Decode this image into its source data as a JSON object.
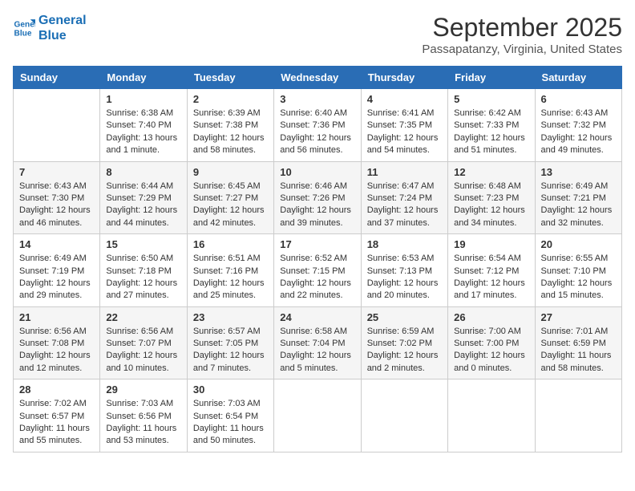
{
  "header": {
    "logo_line1": "General",
    "logo_line2": "Blue",
    "month": "September 2025",
    "location": "Passapatanzy, Virginia, United States"
  },
  "weekdays": [
    "Sunday",
    "Monday",
    "Tuesday",
    "Wednesday",
    "Thursday",
    "Friday",
    "Saturday"
  ],
  "weeks": [
    [
      {
        "day": "",
        "info": ""
      },
      {
        "day": "1",
        "info": "Sunrise: 6:38 AM\nSunset: 7:40 PM\nDaylight: 13 hours\nand 1 minute."
      },
      {
        "day": "2",
        "info": "Sunrise: 6:39 AM\nSunset: 7:38 PM\nDaylight: 12 hours\nand 58 minutes."
      },
      {
        "day": "3",
        "info": "Sunrise: 6:40 AM\nSunset: 7:36 PM\nDaylight: 12 hours\nand 56 minutes."
      },
      {
        "day": "4",
        "info": "Sunrise: 6:41 AM\nSunset: 7:35 PM\nDaylight: 12 hours\nand 54 minutes."
      },
      {
        "day": "5",
        "info": "Sunrise: 6:42 AM\nSunset: 7:33 PM\nDaylight: 12 hours\nand 51 minutes."
      },
      {
        "day": "6",
        "info": "Sunrise: 6:43 AM\nSunset: 7:32 PM\nDaylight: 12 hours\nand 49 minutes."
      }
    ],
    [
      {
        "day": "7",
        "info": "Sunrise: 6:43 AM\nSunset: 7:30 PM\nDaylight: 12 hours\nand 46 minutes."
      },
      {
        "day": "8",
        "info": "Sunrise: 6:44 AM\nSunset: 7:29 PM\nDaylight: 12 hours\nand 44 minutes."
      },
      {
        "day": "9",
        "info": "Sunrise: 6:45 AM\nSunset: 7:27 PM\nDaylight: 12 hours\nand 42 minutes."
      },
      {
        "day": "10",
        "info": "Sunrise: 6:46 AM\nSunset: 7:26 PM\nDaylight: 12 hours\nand 39 minutes."
      },
      {
        "day": "11",
        "info": "Sunrise: 6:47 AM\nSunset: 7:24 PM\nDaylight: 12 hours\nand 37 minutes."
      },
      {
        "day": "12",
        "info": "Sunrise: 6:48 AM\nSunset: 7:23 PM\nDaylight: 12 hours\nand 34 minutes."
      },
      {
        "day": "13",
        "info": "Sunrise: 6:49 AM\nSunset: 7:21 PM\nDaylight: 12 hours\nand 32 minutes."
      }
    ],
    [
      {
        "day": "14",
        "info": "Sunrise: 6:49 AM\nSunset: 7:19 PM\nDaylight: 12 hours\nand 29 minutes."
      },
      {
        "day": "15",
        "info": "Sunrise: 6:50 AM\nSunset: 7:18 PM\nDaylight: 12 hours\nand 27 minutes."
      },
      {
        "day": "16",
        "info": "Sunrise: 6:51 AM\nSunset: 7:16 PM\nDaylight: 12 hours\nand 25 minutes."
      },
      {
        "day": "17",
        "info": "Sunrise: 6:52 AM\nSunset: 7:15 PM\nDaylight: 12 hours\nand 22 minutes."
      },
      {
        "day": "18",
        "info": "Sunrise: 6:53 AM\nSunset: 7:13 PM\nDaylight: 12 hours\nand 20 minutes."
      },
      {
        "day": "19",
        "info": "Sunrise: 6:54 AM\nSunset: 7:12 PM\nDaylight: 12 hours\nand 17 minutes."
      },
      {
        "day": "20",
        "info": "Sunrise: 6:55 AM\nSunset: 7:10 PM\nDaylight: 12 hours\nand 15 minutes."
      }
    ],
    [
      {
        "day": "21",
        "info": "Sunrise: 6:56 AM\nSunset: 7:08 PM\nDaylight: 12 hours\nand 12 minutes."
      },
      {
        "day": "22",
        "info": "Sunrise: 6:56 AM\nSunset: 7:07 PM\nDaylight: 12 hours\nand 10 minutes."
      },
      {
        "day": "23",
        "info": "Sunrise: 6:57 AM\nSunset: 7:05 PM\nDaylight: 12 hours\nand 7 minutes."
      },
      {
        "day": "24",
        "info": "Sunrise: 6:58 AM\nSunset: 7:04 PM\nDaylight: 12 hours\nand 5 minutes."
      },
      {
        "day": "25",
        "info": "Sunrise: 6:59 AM\nSunset: 7:02 PM\nDaylight: 12 hours\nand 2 minutes."
      },
      {
        "day": "26",
        "info": "Sunrise: 7:00 AM\nSunset: 7:00 PM\nDaylight: 12 hours\nand 0 minutes."
      },
      {
        "day": "27",
        "info": "Sunrise: 7:01 AM\nSunset: 6:59 PM\nDaylight: 11 hours\nand 58 minutes."
      }
    ],
    [
      {
        "day": "28",
        "info": "Sunrise: 7:02 AM\nSunset: 6:57 PM\nDaylight: 11 hours\nand 55 minutes."
      },
      {
        "day": "29",
        "info": "Sunrise: 7:03 AM\nSunset: 6:56 PM\nDaylight: 11 hours\nand 53 minutes."
      },
      {
        "day": "30",
        "info": "Sunrise: 7:03 AM\nSunset: 6:54 PM\nDaylight: 11 hours\nand 50 minutes."
      },
      {
        "day": "",
        "info": ""
      },
      {
        "day": "",
        "info": ""
      },
      {
        "day": "",
        "info": ""
      },
      {
        "day": "",
        "info": ""
      }
    ]
  ]
}
